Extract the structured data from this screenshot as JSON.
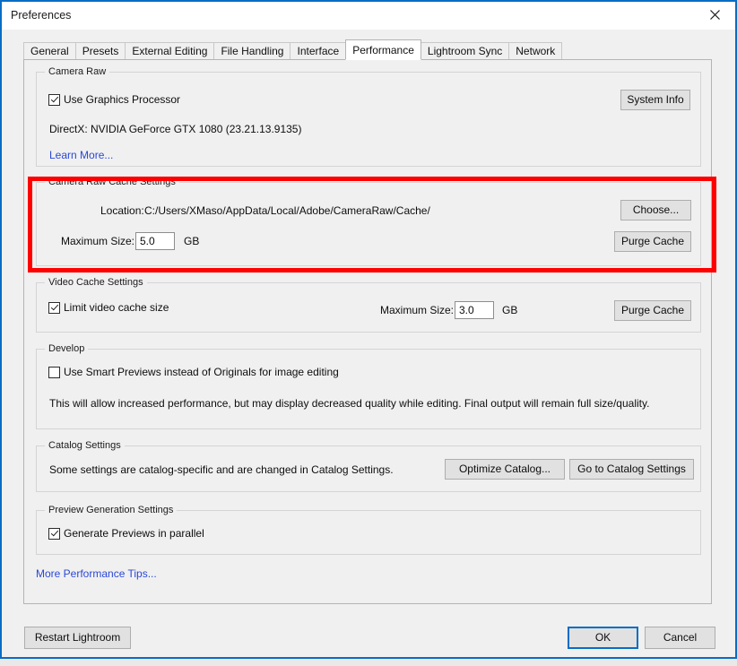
{
  "window": {
    "title": "Preferences",
    "close_icon": "close-icon"
  },
  "tabs": [
    {
      "label": "General",
      "active": false
    },
    {
      "label": "Presets",
      "active": false
    },
    {
      "label": "External Editing",
      "active": false
    },
    {
      "label": "File Handling",
      "active": false
    },
    {
      "label": "Interface",
      "active": false
    },
    {
      "label": "Performance",
      "active": true
    },
    {
      "label": "Lightroom Sync",
      "active": false
    },
    {
      "label": "Network",
      "active": false
    }
  ],
  "groups": {
    "camera_raw": {
      "title": "Camera Raw",
      "use_gpu_label": "Use Graphics Processor",
      "use_gpu_checked": true,
      "gpu_info": "DirectX: NVIDIA GeForce GTX 1080 (23.21.13.9135)",
      "learn_more": "Learn More...",
      "system_info_button": "System Info"
    },
    "camera_raw_cache": {
      "title": "Camera Raw Cache Settings",
      "location_label": "Location:",
      "location_value": "C:/Users/XMaso/AppData/Local/Adobe/CameraRaw/Cache/",
      "max_size_label": "Maximum Size:",
      "max_size_value": "5.0",
      "units": "GB",
      "choose_button": "Choose...",
      "purge_button": "Purge Cache",
      "highlight_color": "#ff0000"
    },
    "video_cache": {
      "title": "Video Cache Settings",
      "limit_label": "Limit video cache size",
      "limit_checked": true,
      "max_size_label": "Maximum Size:",
      "max_size_value": "3.0",
      "units": "GB",
      "purge_button": "Purge Cache"
    },
    "develop": {
      "title": "Develop",
      "smart_previews_label": "Use Smart Previews instead of Originals for image editing",
      "smart_previews_checked": false,
      "description": "This will allow increased performance, but may display decreased quality while editing. Final output will remain full size/quality."
    },
    "catalog": {
      "title": "Catalog Settings",
      "description": "Some settings are catalog-specific and are changed in Catalog Settings.",
      "optimize_button": "Optimize Catalog...",
      "goto_button": "Go to Catalog Settings"
    },
    "preview_generation": {
      "title": "Preview Generation Settings",
      "parallel_label": "Generate Previews in parallel",
      "parallel_checked": true
    }
  },
  "more_tips_link": "More Performance Tips...",
  "footer": {
    "restart_button": "Restart Lightroom",
    "ok_button": "OK",
    "cancel_button": "Cancel"
  }
}
